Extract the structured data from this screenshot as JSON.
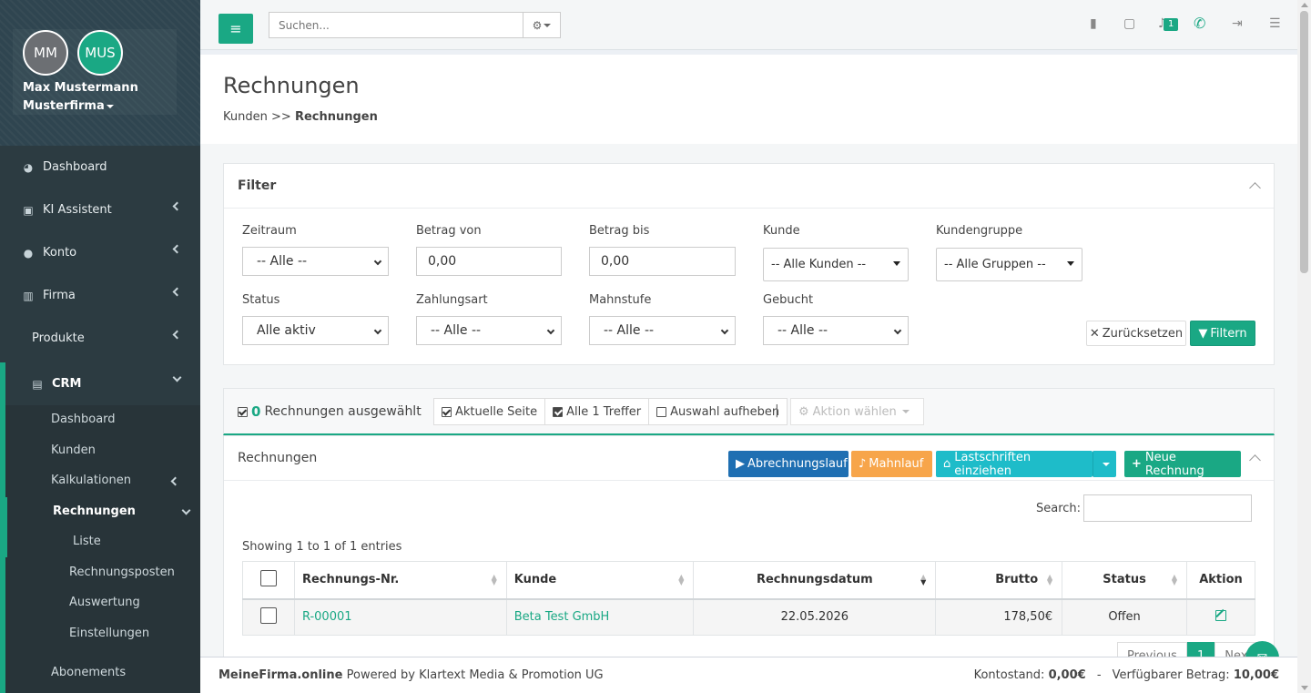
{
  "user": {
    "initials_1": "MM",
    "initials_2": "MUS",
    "name": "Max Mustermann",
    "company": "Musterfirma"
  },
  "sidebar": {
    "items": [
      {
        "label": "Dashboard",
        "icon": "dashboard-icon"
      },
      {
        "label": "KI Assistent",
        "icon": "robot-icon"
      },
      {
        "label": "Konto",
        "icon": "user-icon"
      },
      {
        "label": "Firma",
        "icon": "building-icon"
      },
      {
        "label": "Produkte",
        "icon": ""
      },
      {
        "label": "CRM",
        "icon": "address-card-icon"
      }
    ],
    "crm_sub": {
      "dashboard": "Dashboard",
      "kunden": "Kunden",
      "kalkulationen": "Kalkulationen",
      "rechnungen": "Rechnungen",
      "liste": "Liste",
      "rechnungsposten": "Rechnungsposten",
      "auswertung": "Auswertung",
      "einstellungen": "Einstellungen",
      "abonnements": "Abonements"
    }
  },
  "topbar": {
    "search_placeholder": "Suchen...",
    "notification_count": "1"
  },
  "header": {
    "title": "Rechnungen",
    "breadcrumb_parent": "Kunden",
    "breadcrumb_sep": ">>",
    "breadcrumb_current": "Rechnungen"
  },
  "filter": {
    "title": "Filter",
    "zeitraum_label": "Zeitraum",
    "zeitraum_value": "-- Alle --",
    "betrag_von_label": "Betrag von",
    "betrag_von_value": "0,00",
    "betrag_bis_label": "Betrag bis",
    "betrag_bis_value": "0,00",
    "kunde_label": "Kunde",
    "kunde_value": "-- Alle Kunden --",
    "kundengruppe_label": "Kundengruppe",
    "kundengruppe_value": "-- Alle Gruppen --",
    "status_label": "Status",
    "status_value": "Alle aktiv",
    "zahlungsart_label": "Zahlungsart",
    "zahlungsart_value": "-- Alle --",
    "mahnstufe_label": "Mahnstufe",
    "mahnstufe_value": "-- Alle --",
    "gebucht_label": "Gebucht",
    "gebucht_value": "-- Alle --",
    "reset_label": "Zurücksetzen",
    "apply_label": "Filtern"
  },
  "selection": {
    "count": "0",
    "label": "Rechnungen ausgewählt",
    "sep": "|",
    "current_page": "Aktuelle Seite",
    "all_hits": "Alle 1 Treffer",
    "clear": "Auswahl aufheben",
    "action": "Aktion wählen"
  },
  "invoices": {
    "title": "Rechnungen",
    "btn_run": "Abrechnungslauf",
    "btn_dunning": "Mahnlauf",
    "btn_debit": "Lastschriften einziehen",
    "btn_new": "Neue Rechnung",
    "search_label": "Search:",
    "showing": "Showing 1 to 1 of 1 entries",
    "columns": [
      "Rechnungs-Nr.",
      "Kunde",
      "Rechnungsdatum",
      "Brutto",
      "Status",
      "Aktion"
    ],
    "rows": [
      {
        "nr": "R-00001",
        "kunde": "Beta Test GmbH",
        "datum": "22.05.2026",
        "brutto": "178,50€",
        "status": "Offen"
      }
    ],
    "pagination": {
      "prev": "Previous",
      "page": "1",
      "next": "Next"
    }
  },
  "footer": {
    "brand": "MeineFirma.online",
    "powered": "Powered by Klartext Media & Promotion UG",
    "konto_label": "Kontostand:",
    "konto_value": "0,00€",
    "dash": "-",
    "verf_label": "Verfügbarer Betrag:",
    "verf_value": "10,00€"
  },
  "colors": {
    "accent": "#1aa884",
    "primary": "#1f6fb2",
    "warning": "#f7a54a",
    "info": "#1ebcc9"
  }
}
